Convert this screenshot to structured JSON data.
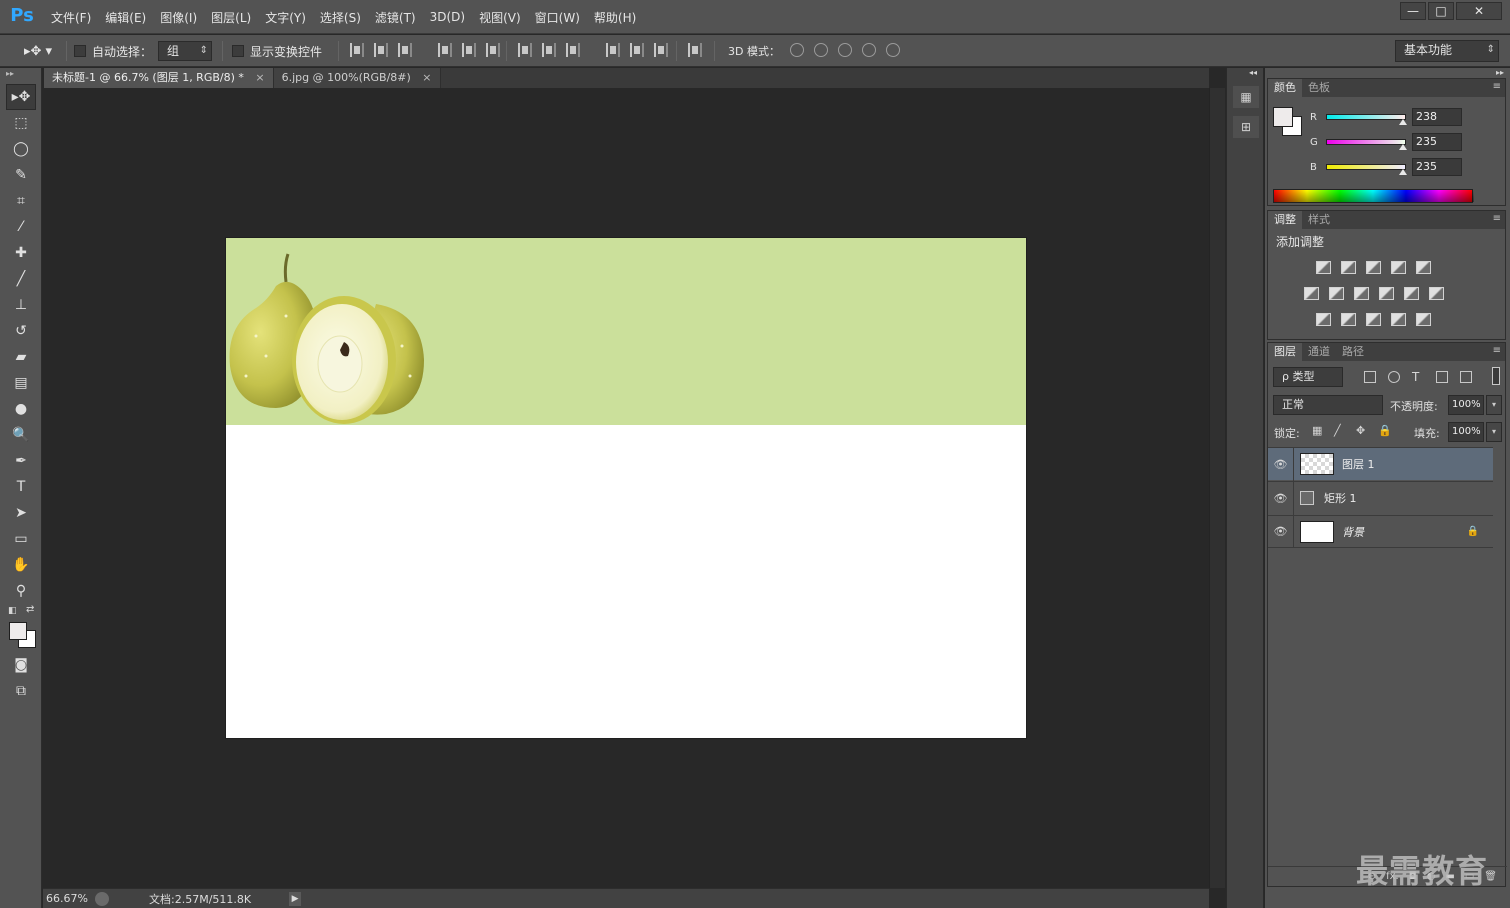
{
  "app": {
    "logo": "Ps"
  },
  "menu": [
    "文件(F)",
    "编辑(E)",
    "图像(I)",
    "图层(L)",
    "文字(Y)",
    "选择(S)",
    "滤镜(T)",
    "3D(D)",
    "视图(V)",
    "窗口(W)",
    "帮助(H)"
  ],
  "window_controls": {
    "minimize": "—",
    "maximize": "□",
    "close": "✕"
  },
  "options": {
    "auto_select_label": "自动选择：",
    "auto_select_value": "组",
    "show_transform_label": "显示变换控件",
    "mode_3d_label": "3D 模式：",
    "workspace_value": "基本功能"
  },
  "tabs": [
    {
      "label": "未标题-1 @ 66.7% (图层 1, RGB/8) *",
      "close": "×",
      "active": true
    },
    {
      "label": "6.jpg @ 100%(RGB/8#)",
      "close": "×",
      "active": false
    }
  ],
  "tools": [
    "move-tool-icon",
    "marquee-tool-icon",
    "lasso-tool-icon",
    "quick-select-tool-icon",
    "crop-tool-icon",
    "eyedropper-tool-icon",
    "healing-brush-icon",
    "brush-tool-icon",
    "stamp-tool-icon",
    "history-brush-icon",
    "eraser-tool-icon",
    "gradient-tool-icon",
    "blur-tool-icon",
    "dodge-tool-icon",
    "pen-tool-icon",
    "type-tool-icon",
    "path-select-icon",
    "rectangle-tool-icon",
    "hand-tool-icon",
    "zoom-tool-icon"
  ],
  "colors": {
    "foreground": "#eeebeb",
    "background": "#ffffff",
    "banner": "#cbe09b",
    "selected_layer": "#5e6b7a"
  },
  "status": {
    "zoom": "66.67%",
    "doc_info": "文档:2.57M/511.8K"
  },
  "color_panel": {
    "tabs": [
      "颜色",
      "色板"
    ],
    "r_label": "R",
    "r": "238",
    "g_label": "G",
    "g": "235",
    "b_label": "B",
    "b": "235"
  },
  "adjust_panel": {
    "tabs": [
      "调整",
      "样式"
    ],
    "title": "添加调整"
  },
  "layers_panel": {
    "tabs": [
      "图层",
      "通道",
      "路径"
    ],
    "filter": "ρ 类型",
    "blend_mode": "正常",
    "opacity_label": "不透明度:",
    "opacity": "100%",
    "lock_label": "锁定:",
    "fill_label": "填充:",
    "fill": "100%",
    "layers": [
      {
        "name": "图层 1",
        "thumb": "checker",
        "selected": true
      },
      {
        "name": "矩形 1",
        "thumb": "shape",
        "selected": false
      },
      {
        "name": "背景",
        "thumb": "white",
        "selected": false,
        "locked": true
      }
    ],
    "footer": [
      "⊝",
      "fx.",
      "◘",
      "◐",
      "▬",
      "▭",
      "🗑"
    ]
  },
  "watermark": "最需教育"
}
